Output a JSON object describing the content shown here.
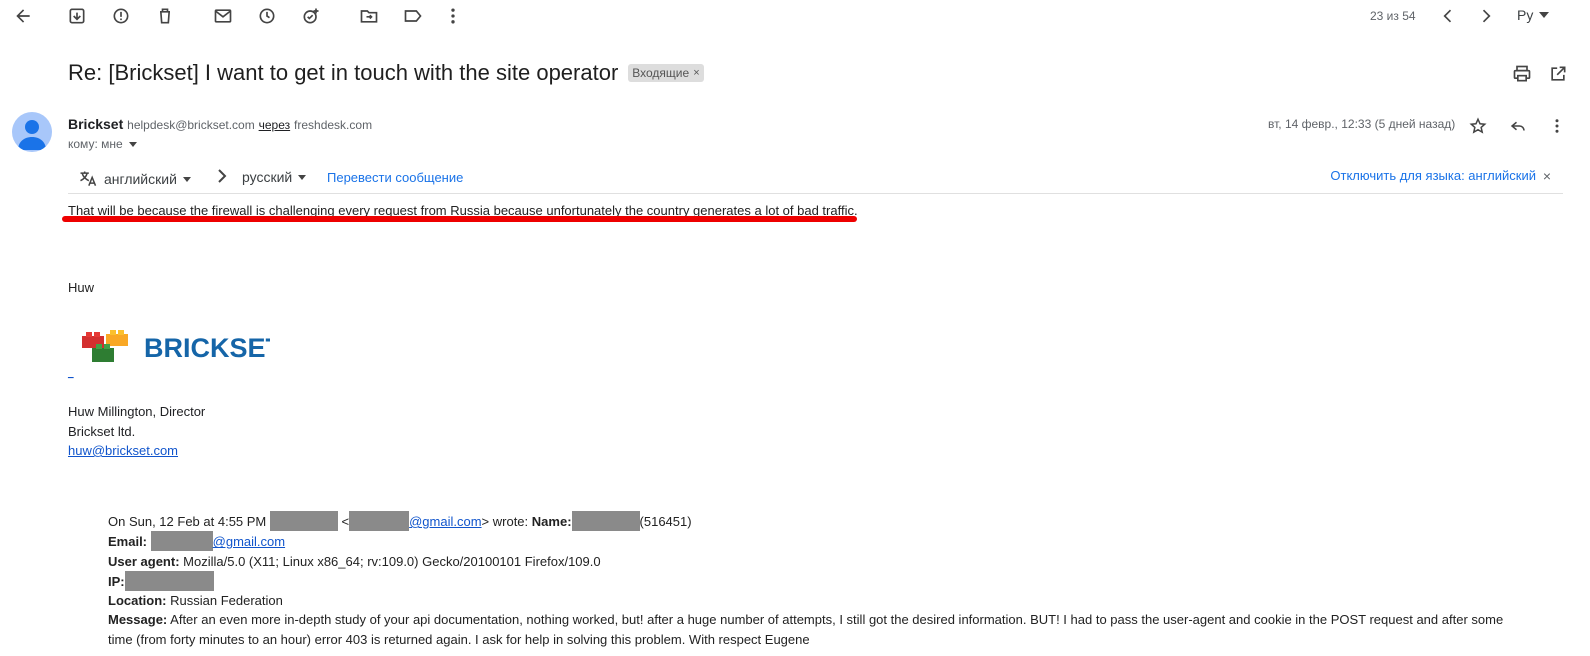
{
  "toolbar": {
    "counter": "23 из 54",
    "lang": "Ру",
    "icons": [
      "arrow-back-icon",
      "archive-icon",
      "report-spam-icon",
      "delete-icon",
      "mark-unread-icon",
      "snooze-icon",
      "add-task-icon",
      "move-to-icon",
      "label-icon",
      "more-vert-icon",
      "chevron-left-icon",
      "chevron-right-icon"
    ]
  },
  "email": {
    "subject": "Re: [Brickset] I want to get in touch with the site operator",
    "label": "Входящие",
    "label_close": "×",
    "sender_name": "Brickset",
    "sender_addr": "helpdesk@brickset.com",
    "via": "через",
    "via_domain": "freshdesk.com",
    "to": "кому: мне",
    "date": "вт, 14 февр., 12:33 (5 дней назад)"
  },
  "translate": {
    "from": "английский",
    "to": "русский",
    "action": "Перевести сообщение",
    "disable": "Отключить для языка: английский",
    "close": "×"
  },
  "body": {
    "line1": "That will be because the firewall is challenging every request from Russia because unfortunately the country generates a lot of bad traffic.",
    "greeting_name": "Huw",
    "logo_text": "BRICKSET",
    "logo_link": "_",
    "sig_name": "Huw Millington, Director",
    "sig_company": "Brickset ltd.",
    "sig_email": "huw@brickset.com"
  },
  "quote": {
    "intro_a": "On Sun, 12 Feb at 4:55 PM",
    "lt": "<",
    "gmail1": "@gmail.com",
    "intro_b": "> wrote:",
    "name_label": "Name:",
    "name_id": "(516451)",
    "email_label": "Email:",
    "gmail2": "@gmail.com",
    "ua_label": "User agent:",
    "ua_value": "Mozilla/5.0 (X11; Linux x86_64; rv:109.0) Gecko/20100101 Firefox/109.0",
    "ip_label": "IP:",
    "location_label": "Location:",
    "location_value": "Russian Federation",
    "message_label": "Message:",
    "message_value": "After an even more in-depth study of your api documentation, nothing worked, but! after a huge number of attempts, I still got the desired information. BUT! I had to pass the user-agent and cookie in the POST request and after some time (from forty minutes to an hour) error 403 is returned again. I ask for help in solving this problem. With respect Eugene"
  },
  "colors": {
    "accent": "#1a73e8",
    "highlight": "#e00000",
    "redaction": "#8a8a8a"
  }
}
